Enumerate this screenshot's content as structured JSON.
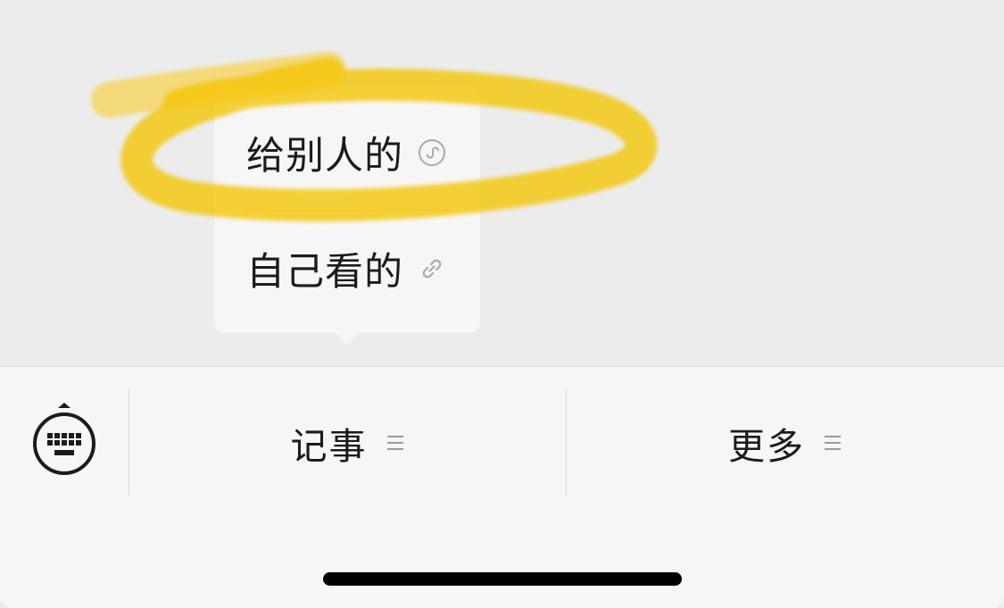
{
  "popup_menu": {
    "items": [
      {
        "label": "给别人的",
        "icon": "mini-program-icon"
      },
      {
        "label": "自己看的",
        "icon": "link-icon"
      }
    ]
  },
  "annotation": {
    "color": "#f5c400"
  },
  "bottom_bar": {
    "keyboard_icon": "keyboard-icon",
    "tabs": [
      {
        "label": "记事",
        "icon": "menu-lines-icon"
      },
      {
        "label": "更多",
        "icon": "menu-lines-icon"
      }
    ]
  }
}
